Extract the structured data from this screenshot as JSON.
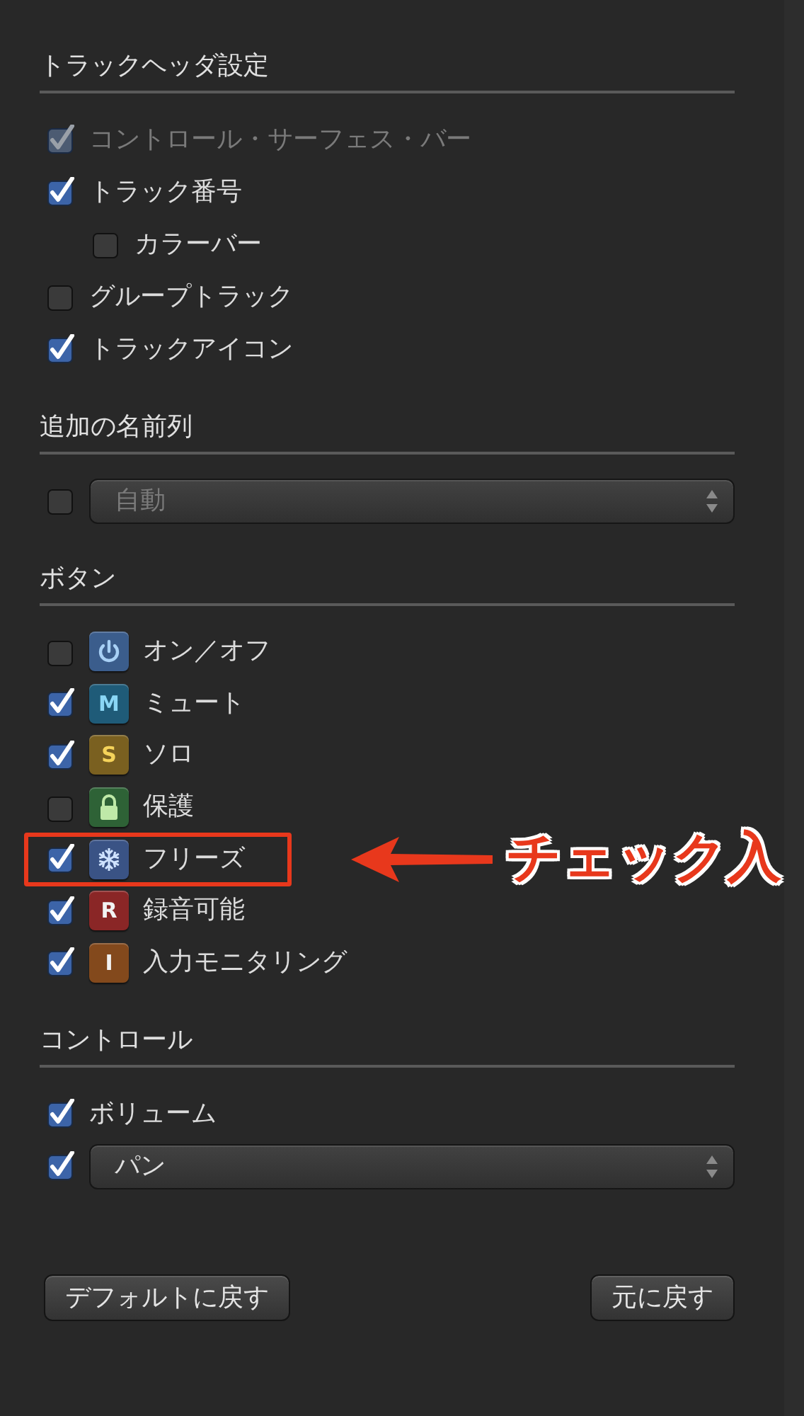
{
  "sections": [
    {
      "title": "トラックヘッダ設定",
      "items": [
        {
          "kind": "checkbox",
          "label": "コントロール・サーフェス・バー",
          "checked": true,
          "disabled": true
        },
        {
          "kind": "checkbox",
          "label": "トラック番号",
          "checked": true,
          "disabled": false,
          "children": [
            {
              "kind": "checkbox",
              "label": "カラーバー",
              "checked": false,
              "disabled": false
            }
          ]
        },
        {
          "kind": "checkbox",
          "label": "グループトラック",
          "checked": false,
          "disabled": false
        },
        {
          "kind": "checkbox",
          "label": "トラックアイコン",
          "checked": true,
          "disabled": false
        }
      ]
    },
    {
      "title": "追加の名前列",
      "items": [
        {
          "kind": "popup",
          "value": "自動",
          "checked": false,
          "disabled": true
        }
      ]
    },
    {
      "title": "ボタン",
      "items": [
        {
          "kind": "button",
          "label": "オン／オフ",
          "checked": false,
          "highlighted": false,
          "badge": {
            "kind": "power",
            "color": "#3b5d8c"
          }
        },
        {
          "kind": "button",
          "label": "ミュート",
          "checked": true,
          "highlighted": false,
          "badge": {
            "kind": "letter",
            "text": "M",
            "color": "#1f5b78"
          }
        },
        {
          "kind": "button",
          "label": "ソロ",
          "checked": true,
          "highlighted": false,
          "badge": {
            "kind": "letter",
            "text": "S",
            "color": "#7a6020"
          }
        },
        {
          "kind": "button",
          "label": "保護",
          "checked": false,
          "highlighted": false,
          "badge": {
            "kind": "lock",
            "color": "#2e6236"
          }
        },
        {
          "kind": "button",
          "label": "フリーズ",
          "checked": true,
          "highlighted": true,
          "badge": {
            "kind": "snowflake",
            "color": "#3a5385"
          }
        },
        {
          "kind": "button",
          "label": "録音可能",
          "checked": true,
          "highlighted": false,
          "badge": {
            "kind": "letter",
            "text": "R",
            "color": "#8a2626"
          }
        },
        {
          "kind": "button",
          "label": "入力モニタリング",
          "checked": true,
          "highlighted": false,
          "badge": {
            "kind": "letter",
            "text": "I",
            "color": "#83491c"
          }
        }
      ]
    },
    {
      "title": "コントロール",
      "items": [
        {
          "kind": "checkbox",
          "label": "ボリューム",
          "checked": true,
          "disabled": false
        },
        {
          "kind": "popup",
          "value": "パン",
          "checked": true,
          "disabled": false
        }
      ]
    }
  ],
  "callout": "チェック入",
  "footer_buttons": [
    "デフォルトに戻す",
    "元に戻す"
  ]
}
